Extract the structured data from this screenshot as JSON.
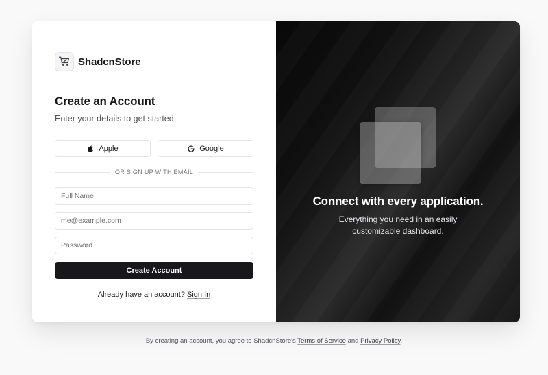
{
  "brand": {
    "name": "ShadcnStore",
    "logo_icon": "shopping-cart-icon"
  },
  "form": {
    "title": "Create an Account",
    "subtitle": "Enter your details to get started.",
    "apple_label": "Apple",
    "google_label": "Google",
    "divider_text": "OR SIGN UP WITH EMAIL",
    "fields": [
      {
        "placeholder": "Full Name",
        "value": ""
      },
      {
        "placeholder": "me@example.com",
        "value": ""
      },
      {
        "placeholder": "Password",
        "value": ""
      }
    ],
    "submit_label": "Create Account",
    "signin_prompt": "Already have an account?",
    "signin_link": "Sign In"
  },
  "hero": {
    "title": "Connect with every application.",
    "subtitle": "Everything you need in an easily customizable dashboard."
  },
  "footer": {
    "text_before": "By creating an account, you agree to ShadcnStore's",
    "terms_link": "Terms of Service",
    "and": "and",
    "privacy_link": "Privacy Policy",
    "end": "."
  },
  "colors": {
    "primary_button": "#18181b",
    "panel_dark": "#0b0b0b",
    "border": "#e4e4e7"
  }
}
